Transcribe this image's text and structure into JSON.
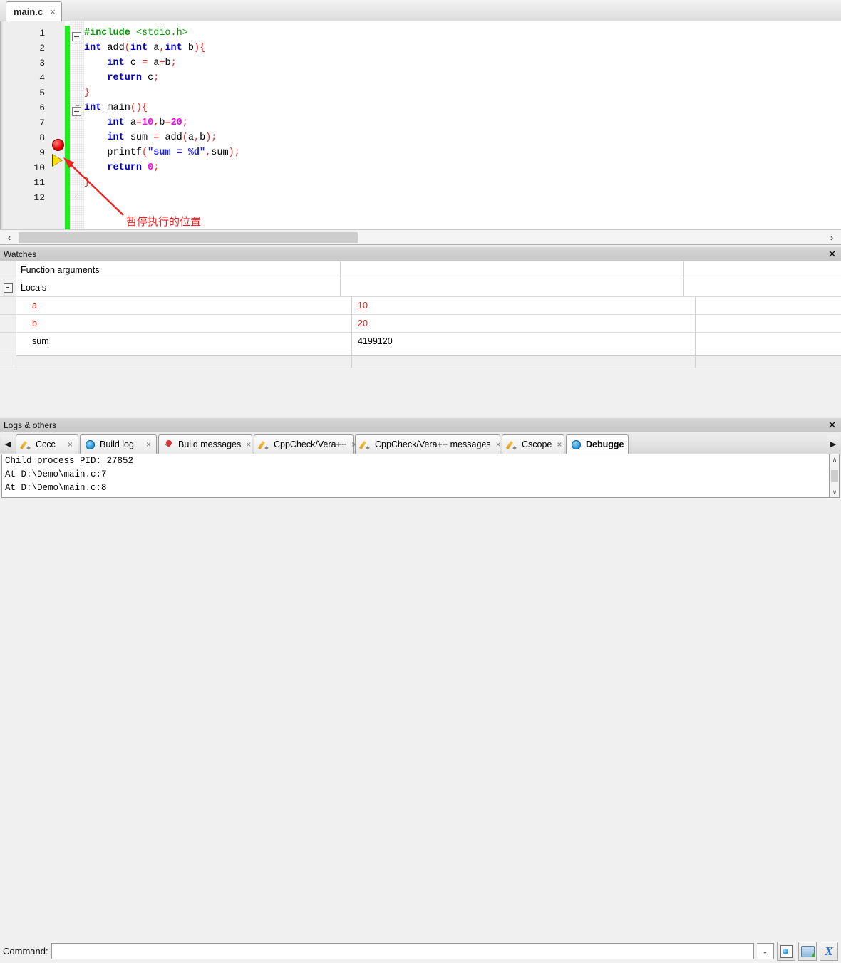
{
  "editor": {
    "tab": {
      "label": "main.c",
      "close": "×"
    },
    "lines": [
      {
        "n": "1",
        "tokens": [
          {
            "t": "#include ",
            "c": "pp"
          },
          {
            "t": "<stdio.h>",
            "c": "hdr"
          }
        ]
      },
      {
        "n": "2",
        "tokens": [
          {
            "t": "int",
            "c": "k"
          },
          {
            "t": " add",
            "c": "id"
          },
          {
            "t": "(",
            "c": "br"
          },
          {
            "t": "int",
            "c": "k"
          },
          {
            "t": " a",
            "c": "id"
          },
          {
            "t": ",",
            "c": "br"
          },
          {
            "t": "int",
            "c": "k"
          },
          {
            "t": " b",
            "c": "id"
          },
          {
            "t": "){",
            "c": "br"
          }
        ]
      },
      {
        "n": "3",
        "tokens": [
          {
            "t": "    ",
            "c": "id"
          },
          {
            "t": "int",
            "c": "k"
          },
          {
            "t": " c ",
            "c": "id"
          },
          {
            "t": "=",
            "c": "op"
          },
          {
            "t": " a",
            "c": "id"
          },
          {
            "t": "+",
            "c": "op"
          },
          {
            "t": "b",
            "c": "id"
          },
          {
            "t": ";",
            "c": "br"
          }
        ]
      },
      {
        "n": "4",
        "tokens": [
          {
            "t": "    ",
            "c": "id"
          },
          {
            "t": "return",
            "c": "k"
          },
          {
            "t": " c",
            "c": "id"
          },
          {
            "t": ";",
            "c": "br"
          }
        ]
      },
      {
        "n": "5",
        "tokens": [
          {
            "t": "}",
            "c": "br"
          }
        ]
      },
      {
        "n": "6",
        "tokens": [
          {
            "t": "int",
            "c": "k"
          },
          {
            "t": " main",
            "c": "id"
          },
          {
            "t": "(){",
            "c": "br"
          }
        ]
      },
      {
        "n": "7",
        "tokens": [
          {
            "t": "    ",
            "c": "id"
          },
          {
            "t": "int",
            "c": "k"
          },
          {
            "t": " a",
            "c": "id"
          },
          {
            "t": "=",
            "c": "op"
          },
          {
            "t": "10",
            "c": "num"
          },
          {
            "t": ",",
            "c": "br"
          },
          {
            "t": "b",
            "c": "id"
          },
          {
            "t": "=",
            "c": "op"
          },
          {
            "t": "20",
            "c": "num"
          },
          {
            "t": ";",
            "c": "br"
          }
        ]
      },
      {
        "n": "8",
        "tokens": [
          {
            "t": "    ",
            "c": "id"
          },
          {
            "t": "int",
            "c": "k"
          },
          {
            "t": " sum ",
            "c": "id"
          },
          {
            "t": "=",
            "c": "op"
          },
          {
            "t": " add",
            "c": "id"
          },
          {
            "t": "(",
            "c": "br"
          },
          {
            "t": "a",
            "c": "id"
          },
          {
            "t": ",",
            "c": "br"
          },
          {
            "t": "b",
            "c": "id"
          },
          {
            "t": ");",
            "c": "br"
          }
        ]
      },
      {
        "n": "9",
        "tokens": [
          {
            "t": "    printf",
            "c": "id"
          },
          {
            "t": "(",
            "c": "br"
          },
          {
            "t": "\"sum = %d\"",
            "c": "str"
          },
          {
            "t": ",",
            "c": "br"
          },
          {
            "t": "sum",
            "c": "id"
          },
          {
            "t": ");",
            "c": "br"
          }
        ]
      },
      {
        "n": "10",
        "tokens": [
          {
            "t": "    ",
            "c": "id"
          },
          {
            "t": "return",
            "c": "k"
          },
          {
            "t": " ",
            "c": "id"
          },
          {
            "t": "0",
            "c": "num"
          },
          {
            "t": ";",
            "c": "br"
          }
        ]
      },
      {
        "n": "11",
        "tokens": [
          {
            "t": "}",
            "c": "br"
          }
        ]
      },
      {
        "n": "12",
        "tokens": []
      }
    ],
    "markers": {
      "breakpoint_line": "7",
      "execution_line": "8"
    },
    "annotation": {
      "text": "暂停执行的位置",
      "color": "#f02020"
    },
    "hscroll": {
      "left_arrow": "‹",
      "right_arrow": "›"
    }
  },
  "watches": {
    "title": "Watches",
    "close": "×",
    "rows": [
      {
        "tree": "",
        "name": "Function arguments",
        "value": "",
        "name_red": false,
        "value_red": false
      },
      {
        "tree": "-",
        "name": "Locals",
        "value": "",
        "name_red": false,
        "value_red": false
      },
      {
        "tree": "",
        "name": "a",
        "value": "10",
        "name_red": true,
        "value_red": true
      },
      {
        "tree": "",
        "name": "b",
        "value": "20",
        "name_red": true,
        "value_red": true
      },
      {
        "tree": "",
        "name": "sum",
        "value": "4199120",
        "name_red": false,
        "value_red": false
      },
      {
        "tree": "",
        "name": "",
        "value": "",
        "name_red": false,
        "value_red": false
      }
    ]
  },
  "logs": {
    "title": "Logs & others",
    "close": "×",
    "scroll_left": "◀",
    "scroll_right": "▶",
    "tabs": [
      {
        "label": "Cccc",
        "icon": "pencil-icon",
        "active": false,
        "close": "×"
      },
      {
        "label": "Build log",
        "icon": "gear-icon",
        "active": false,
        "close": "×"
      },
      {
        "label": "Build messages",
        "icon": "pin-icon",
        "active": false,
        "close": "×"
      },
      {
        "label": "CppCheck/Vera++",
        "icon": "pencil-icon",
        "active": false,
        "close": "×"
      },
      {
        "label": "CppCheck/Vera++ messages",
        "icon": "pencil-icon",
        "active": false,
        "close": "×"
      },
      {
        "label": "Cscope",
        "icon": "pencil-icon",
        "active": false,
        "close": "×"
      },
      {
        "label": "Debugge",
        "icon": "gear-icon",
        "active": true,
        "close": ""
      }
    ],
    "output": [
      "Child process PID: 27852",
      "At D:\\Demo\\main.c:7",
      "At D:\\Demo\\main.c:8"
    ],
    "vscroll": {
      "up": "∧",
      "down": "∨"
    },
    "command": {
      "label": "Command:",
      "value": "",
      "placeholder": "",
      "dropdown": "⌄",
      "buttons": [
        {
          "name": "debug-window-button",
          "icon": "file-blue-dot-icon"
        },
        {
          "name": "open-folder-button",
          "icon": "folder-green-arrow-icon"
        },
        {
          "name": "stop-debugger-button",
          "icon": "blue-x-icon",
          "glyph": "X"
        }
      ]
    }
  }
}
